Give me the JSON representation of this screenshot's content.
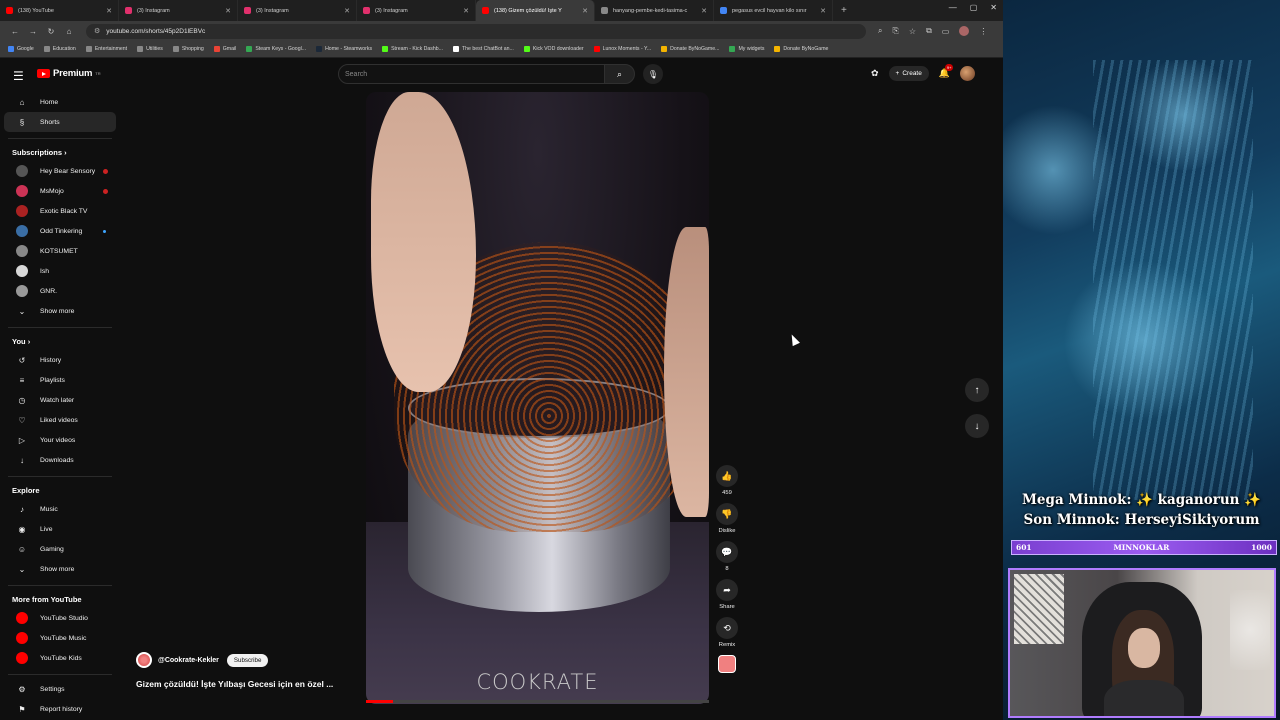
{
  "browser": {
    "tabs": [
      {
        "title": "(138) YouTube",
        "color": "#ff0000"
      },
      {
        "title": "(3) Instagram",
        "color": "#e1306c"
      },
      {
        "title": "(3) Instagram",
        "color": "#e1306c"
      },
      {
        "title": "(3) Instagram",
        "color": "#e1306c"
      },
      {
        "title": "(138) Gizem çözüldü! İşte Y",
        "color": "#ff0000",
        "active": true
      },
      {
        "title": "hanyang-pembe-kedi-tasima-c",
        "color": "#888888"
      },
      {
        "title": "pegasus evcil hayvan kilo sınır",
        "color": "#4285f4"
      }
    ],
    "url": "youtube.com/shorts/45p2D1lEBVc",
    "bookmarks": [
      {
        "label": "Google",
        "color": "#4285f4"
      },
      {
        "label": "Education",
        "color": "#888888"
      },
      {
        "label": "Entertainment",
        "color": "#888888"
      },
      {
        "label": "Utilities",
        "color": "#888888"
      },
      {
        "label": "Shopping",
        "color": "#888888"
      },
      {
        "label": "Gmail",
        "color": "#ea4335"
      },
      {
        "label": "Steam Keys - Googl...",
        "color": "#34a853"
      },
      {
        "label": "Home - Steamworks",
        "color": "#1b2838"
      },
      {
        "label": "Stream - Kick Dashb...",
        "color": "#53fc18"
      },
      {
        "label": "The best ChatBot an...",
        "color": "#ffffff"
      },
      {
        "label": "Kick VOD downloader",
        "color": "#53fc18"
      },
      {
        "label": "Lunox Moments - Y...",
        "color": "#ff0000"
      },
      {
        "label": "Donate ByNoGame...",
        "color": "#f4b400"
      },
      {
        "label": "My widgets",
        "color": "#34a853"
      },
      {
        "label": "Donate ByNoGame",
        "color": "#f4b400"
      }
    ]
  },
  "youtube": {
    "logo_text": "Premium",
    "logo_sup": "TR",
    "search_placeholder": "Search",
    "create_label": "Create",
    "notif_badge": "9+",
    "sidebar": {
      "main": [
        {
          "label": "Home",
          "icon": "home-icon",
          "glyph": "⌂"
        },
        {
          "label": "Shorts",
          "icon": "shorts-icon",
          "glyph": "§",
          "active": true
        }
      ],
      "subscriptions_title": "Subscriptions",
      "subscriptions": [
        {
          "label": "Hey Bear Sensory",
          "color": "#555555",
          "live": true
        },
        {
          "label": "MsMojo",
          "color": "#cc3355",
          "live": true
        },
        {
          "label": "Exotic Black TV",
          "color": "#aa2222"
        },
        {
          "label": "Odd Tinkering",
          "color": "#3a6ea5",
          "dot": true
        },
        {
          "label": "KOTSUMET",
          "color": "#888888"
        },
        {
          "label": "Ish",
          "color": "#d8d8d8"
        },
        {
          "label": "GNR.",
          "color": "#999999"
        }
      ],
      "show_more": "Show more",
      "you_title": "You",
      "you": [
        {
          "label": "History",
          "icon": "history-icon",
          "glyph": "↺"
        },
        {
          "label": "Playlists",
          "icon": "playlists-icon",
          "glyph": "≡"
        },
        {
          "label": "Watch later",
          "icon": "watch-later-icon",
          "glyph": "◷"
        },
        {
          "label": "Liked videos",
          "icon": "like-icon",
          "glyph": "♡"
        },
        {
          "label": "Your videos",
          "icon": "your-videos-icon",
          "glyph": "▷"
        },
        {
          "label": "Downloads",
          "icon": "download-icon",
          "glyph": "↓"
        }
      ],
      "explore_title": "Explore",
      "explore": [
        {
          "label": "Music",
          "icon": "music-icon",
          "glyph": "♪"
        },
        {
          "label": "Live",
          "icon": "live-icon",
          "glyph": "◉"
        },
        {
          "label": "Gaming",
          "icon": "gaming-icon",
          "glyph": "☺"
        }
      ],
      "show_more_2": "Show more",
      "more_title": "More from YouTube",
      "more": [
        {
          "label": "YouTube Studio",
          "color": "#ff0000"
        },
        {
          "label": "YouTube Music",
          "color": "#ff0000"
        },
        {
          "label": "YouTube Kids",
          "color": "#ff0000"
        }
      ],
      "settings": "Settings",
      "report": "Report history"
    },
    "short": {
      "watermark": "COOKRATE",
      "channel": "@Cookrate-Kekler",
      "subscribe": "Subscribe",
      "title": "Gizem çözüldü! İşte Yılbaşı Gecesi için en özel ...",
      "progress": 0.08,
      "actions": [
        {
          "name": "like",
          "glyph": "👍",
          "label": "459"
        },
        {
          "name": "dislike",
          "glyph": "👎",
          "label": "Dislike"
        },
        {
          "name": "comments",
          "glyph": "💬",
          "label": "8"
        },
        {
          "name": "share",
          "glyph": "➦",
          "label": "Share"
        },
        {
          "name": "remix",
          "glyph": "⟲",
          "label": "Remix"
        }
      ]
    }
  },
  "stream_overlay": {
    "mega_minnok": "Mega Minnok: ✨ kaganorun ✨",
    "son_minnok": "Son Minnok: HerseyiSikiyorum",
    "goal_current": "601",
    "goal_label": "MINNOKLAR",
    "goal_target": "1000"
  }
}
